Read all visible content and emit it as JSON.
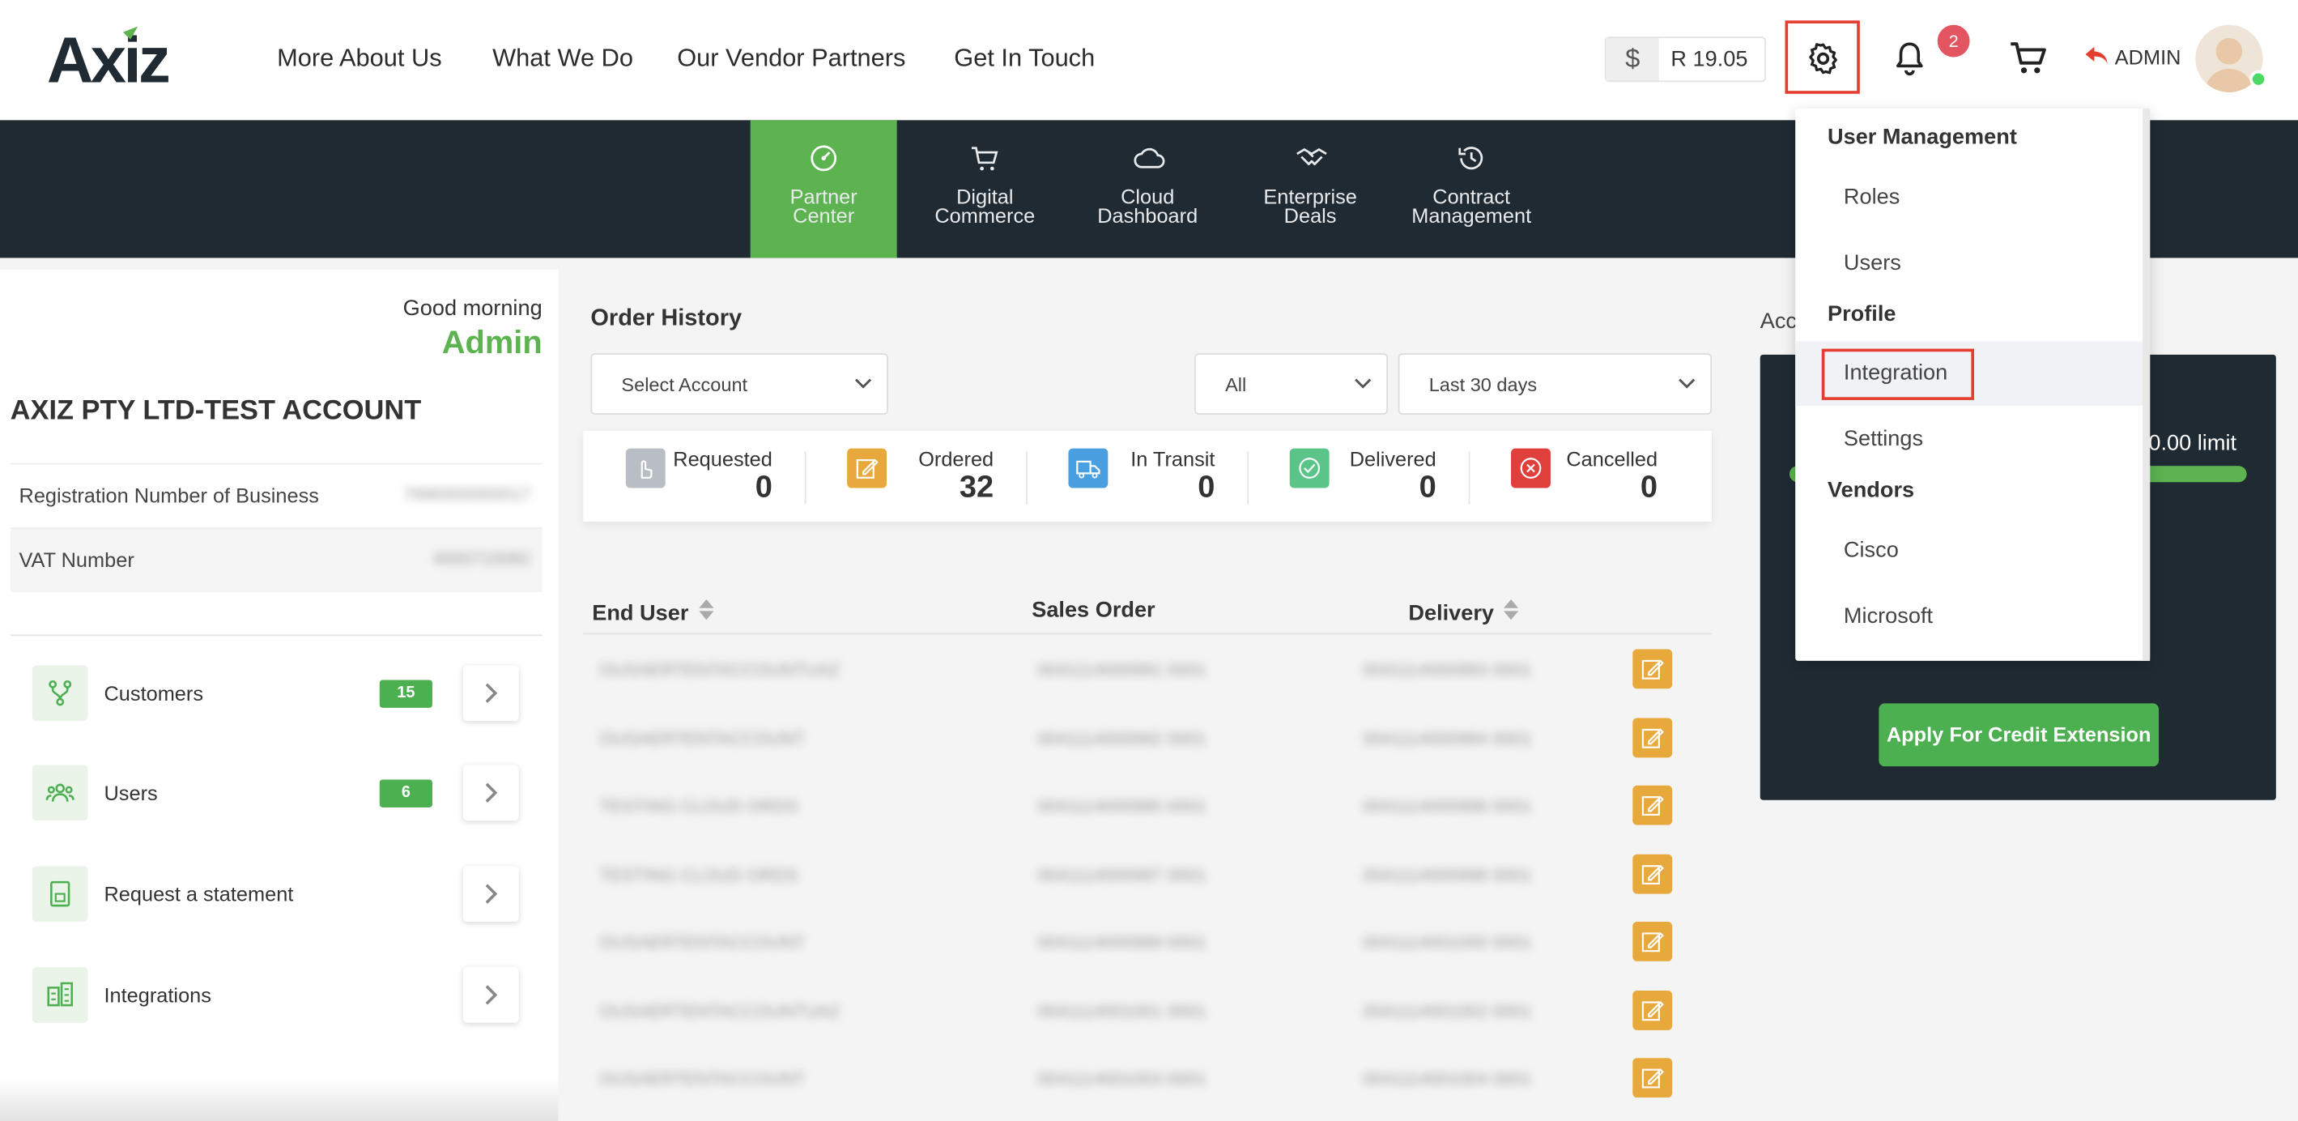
{
  "brand": {
    "logo_text": "Axiz"
  },
  "top_nav": [
    "More About Us",
    "What We Do",
    "Our Vendor Partners",
    "Get In Touch"
  ],
  "credit": {
    "symbol": "$",
    "value": "R 19.05"
  },
  "notifications": {
    "count": "2"
  },
  "user": {
    "label": "ADMIN"
  },
  "main_nav": [
    {
      "line1": "Partner",
      "line2": "Center",
      "icon": "gauge-icon",
      "active": true
    },
    {
      "line1": "Digital",
      "line2": "Commerce",
      "icon": "cart-icon",
      "active": false
    },
    {
      "line1": "Cloud",
      "line2": "Dashboard",
      "icon": "cloud-icon",
      "active": false
    },
    {
      "line1": "Enterprise",
      "line2": "Deals",
      "icon": "handshake-icon",
      "active": false
    },
    {
      "line1": "Contract",
      "line2": "Management",
      "icon": "history-icon",
      "active": false
    }
  ],
  "left": {
    "greeting": "Good morning",
    "name": "Admin",
    "company": "AXIZ PTY LTD-TEST ACCOUNT",
    "info": [
      {
        "label": "Registration Number of Business",
        "value": "7890000000017"
      },
      {
        "label": "VAT Number",
        "value": "4000710082"
      }
    ],
    "menu": [
      {
        "label": "Customers",
        "badge": "15"
      },
      {
        "label": "Users",
        "badge": "6"
      },
      {
        "label": "Request a statement",
        "badge": ""
      },
      {
        "label": "Integrations",
        "badge": ""
      }
    ]
  },
  "orders": {
    "title": "Order History",
    "select_account": "Select Account",
    "filter_status": "All",
    "filter_period": "Last 30 days",
    "stats": [
      {
        "label": "Requested",
        "value": "0",
        "color": "#b8bec4"
      },
      {
        "label": "Ordered",
        "value": "32",
        "color": "#e8a93c"
      },
      {
        "label": "In Transit",
        "value": "0",
        "color": "#4a9fe0"
      },
      {
        "label": "Delivered",
        "value": "0",
        "color": "#5bc589"
      },
      {
        "label": "Cancelled",
        "value": "0",
        "color": "#e0403c"
      }
    ],
    "columns": [
      "End User",
      "Sales Order",
      "Delivery"
    ],
    "rows": [
      [
        "OUSAERTENTACCOUNTUAZ",
        "0041114000991 0001",
        "0041114000993 0001"
      ],
      [
        "OUSAERTENTACCOUNT",
        "0041114000992 0001",
        "0041114000994 0001"
      ],
      [
        "TESTING CLOUD ORDS",
        "0041114000995 0001",
        "0041114000996 0001"
      ],
      [
        "TESTING CLOUD ORDS",
        "0041114000997 0001",
        "0041114000998 0001"
      ],
      [
        "OUSAERTENTACCOUNT",
        "0041114000999 0001",
        "0041114001000 0001"
      ],
      [
        "OUSAERTENTACCOUNTUAZ",
        "0041114001001 0001",
        "0041114001002 0001"
      ],
      [
        "OUSAERTENTACCOUNT",
        "0041114001003 0001",
        "0041114001004 0001"
      ]
    ]
  },
  "account": {
    "title": "Acc",
    "limit_text": "0.00 limit",
    "apply_label": "Apply For Credit Extension"
  },
  "dropdown": {
    "sections": [
      {
        "head": "User Management",
        "items": [
          "Roles",
          "Users"
        ]
      },
      {
        "head": "Profile",
        "items": [
          "Integration",
          "Settings"
        ]
      },
      {
        "head": "Vendors",
        "items": [
          "Cisco",
          "Microsoft"
        ]
      }
    ]
  }
}
